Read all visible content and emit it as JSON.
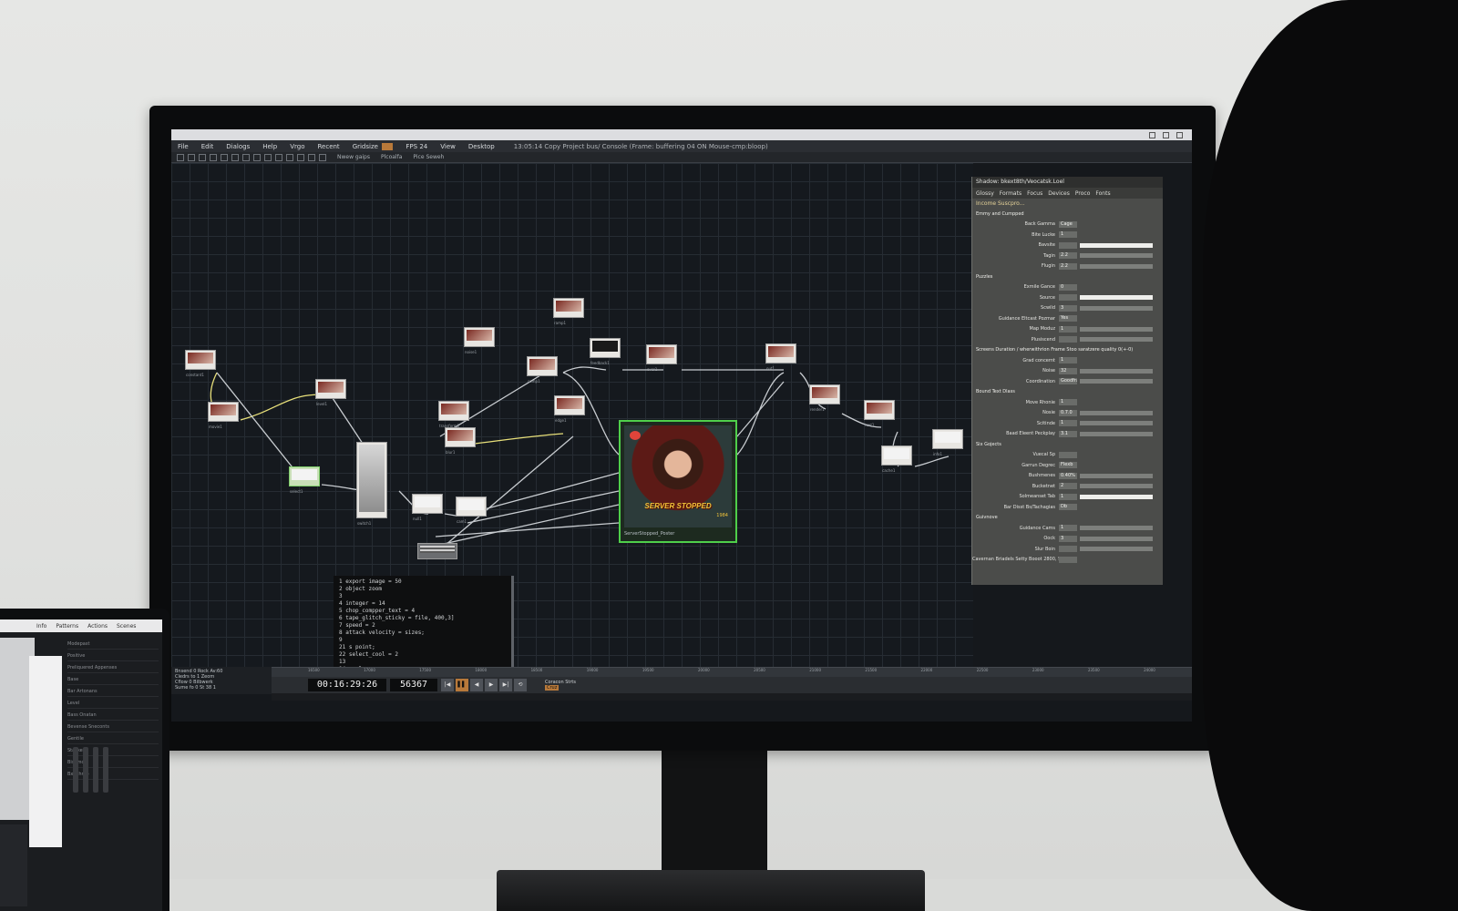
{
  "menubar": {
    "items": [
      "File",
      "Edit",
      "Dialogs",
      "Help"
    ],
    "extra": [
      "Vrgo",
      "Recent",
      "Gridsize",
      "FPS 24",
      "View",
      "Desktop"
    ],
    "status_text": "13:05:14 Copy Project bus/ Console (Frame: buffering 04 ON Mouse-cmp:bloop)"
  },
  "toolbar": {
    "item_count": 14,
    "field_one": "Nwew gaips",
    "field_two": "Plcoalfa",
    "field_three": "Pice Seweh"
  },
  "network": {
    "nodes": [
      {
        "label": "constant1",
        "style": "red"
      },
      {
        "label": "movie1",
        "style": "red"
      },
      {
        "label": "level1",
        "style": "red"
      },
      {
        "label": "select1",
        "style": "white"
      },
      {
        "label": "switch1",
        "style": "white"
      },
      {
        "label": "null1",
        "style": "white"
      },
      {
        "label": "transform1",
        "style": "red"
      },
      {
        "label": "blur1",
        "style": "red"
      },
      {
        "label": "comp1",
        "style": "red"
      },
      {
        "label": "feedback1",
        "style": "dark"
      },
      {
        "label": "cam1",
        "style": "white"
      },
      {
        "label": "edge1",
        "style": "red"
      },
      {
        "label": "noise1",
        "style": "red"
      },
      {
        "label": "ramp1",
        "style": "red"
      },
      {
        "label": "over1",
        "style": "red"
      },
      {
        "label": "out1",
        "style": "red"
      },
      {
        "label": "render1",
        "style": "red"
      },
      {
        "label": "text1",
        "style": "red"
      },
      {
        "label": "cache1",
        "style": "white"
      },
      {
        "label": "info1",
        "style": "white"
      }
    ],
    "main_node": {
      "label": "ServerStopped_Poster",
      "poster_text": "SERVER STOPPED",
      "poster_sub": "1984"
    }
  },
  "code": {
    "lines": [
      "1  export image = 50",
      "2  object zoom",
      "3",
      "4  integer = 14",
      "5  chop_compper_text = 4",
      "6  tape_glitch_sticky = file, 400,3]",
      "7  speed = 2",
      "8  attack velocity = sizes;",
      "9",
      "21 s point;",
      "22 select_cool = 2",
      "13",
      "14 s clamp",
      "15 overtype = -3",
      "16 swing_boundi = 0"
    ]
  },
  "params": {
    "header": "Shadow: bkext8th/Veocatsk.Loel",
    "tabs": [
      "Glossy",
      "Formats",
      "Focus",
      "Devices",
      "Proco",
      "Fonts"
    ],
    "subhead": "Income Suscpro...",
    "rows": [
      {
        "section": true,
        "label": "Emmy and Cumpped"
      },
      {
        "label": "Back Gamma",
        "value": "Cage",
        "bar": "none"
      },
      {
        "label": "Bite Lucke",
        "value": "1",
        "bar": "none"
      },
      {
        "label": "Bavsite",
        "value": "",
        "bar": "white"
      },
      {
        "label": "Tagin",
        "value": "2.2",
        "bar": "grey"
      },
      {
        "label": "Flugin",
        "value": "2.2",
        "bar": "grey"
      },
      {
        "section": true,
        "label": "Puzzles"
      },
      {
        "label": "Exmile Gance",
        "value": "0",
        "bar": "none"
      },
      {
        "label": "Source",
        "value": "",
        "bar": "white"
      },
      {
        "label": "Scwild",
        "value": "3",
        "bar": "grey"
      },
      {
        "label": "Guidance Eltcast Pozmar",
        "value": "Yes",
        "bar": "none"
      },
      {
        "label": "Map Moduz",
        "value": "1",
        "bar": "grey"
      },
      {
        "label": "Plusiscend",
        "value": "",
        "bar": "grey"
      },
      {
        "section": true,
        "label": "Screens Duration / wherwithrion Frame Stoo saratzere quality 0(+-0)"
      },
      {
        "label": "Grad concernt",
        "value": "1",
        "bar": "none"
      },
      {
        "label": "Noise",
        "value": "32",
        "bar": "grey"
      },
      {
        "label": "Coordination",
        "value": "Goodfrance",
        "bar": "grey"
      },
      {
        "section": true,
        "label": "Bound Text Dlass"
      },
      {
        "label": "Move Rhonie",
        "value": "1",
        "bar": "none"
      },
      {
        "label": "Nosie",
        "value": "0.7.0",
        "bar": "grey"
      },
      {
        "label": "Scitinde",
        "value": "1",
        "bar": "grey"
      },
      {
        "label": "Baad Eleent Peckplay",
        "value": "3.1",
        "bar": "grey"
      },
      {
        "section": true,
        "label": "Six Gojects"
      },
      {
        "label": "Vuecal Sp",
        "value": "",
        "bar": "none"
      },
      {
        "label": "Garrun Degrec",
        "value": "Flexb",
        "bar": "none"
      },
      {
        "label": "Bushmenes",
        "value": "0.40%",
        "bar": "grey"
      },
      {
        "label": "Bucketnet",
        "value": "2",
        "bar": "grey"
      },
      {
        "label": "Solmeanset Tab",
        "value": "1",
        "bar": "white"
      },
      {
        "label": "Bar Disst Bs/Tachagias",
        "value": "Db",
        "bar": "none"
      },
      {
        "section": true,
        "label": "Guivnove"
      },
      {
        "label": "Guidance Cams",
        "value": "1",
        "bar": "grey"
      },
      {
        "label": "Oock",
        "value": "3",
        "bar": "grey"
      },
      {
        "label": "Slur Boin",
        "value": "",
        "bar": "grey"
      },
      {
        "label": "Cavernan Briadels Setty Booot 2800, 5,30 1, 5x43",
        "value": "",
        "bar": "none"
      }
    ]
  },
  "infobar": {
    "lines": [
      "Bnsend  0  Rock  Av:60",
      "Cledrs to  1  Zeom  ",
      "Cflow  0  Bilbwerk  ",
      "Sume fo  0  St 38 1  "
    ]
  },
  "timeline": {
    "timecode": "00:16:29:26",
    "frame": "56367",
    "ticks": [
      "16500",
      "17000",
      "17500",
      "18000",
      "18500",
      "19000",
      "19500",
      "20000",
      "20500",
      "21000",
      "21500",
      "22000",
      "22500",
      "23000",
      "23500",
      "24000"
    ],
    "controls": [
      "|◀",
      "▌▌",
      "◀",
      "▶",
      "▶|",
      "⟲"
    ],
    "mode_label": "Coracon Strts",
    "mode_value": "Cruz"
  },
  "laptop": {
    "menu": [
      "Info",
      "Patterns",
      "Actions",
      "Scenes"
    ],
    "rows": [
      "Modepast",
      "Positive",
      "Preliquered Appenses",
      "Base",
      "Bar Artonans",
      "Level",
      "Bass Onatan",
      "Bevense Sneconts",
      "Gentile",
      "Stacked",
      "Bisumo",
      "Bxlibhmb"
    ]
  }
}
